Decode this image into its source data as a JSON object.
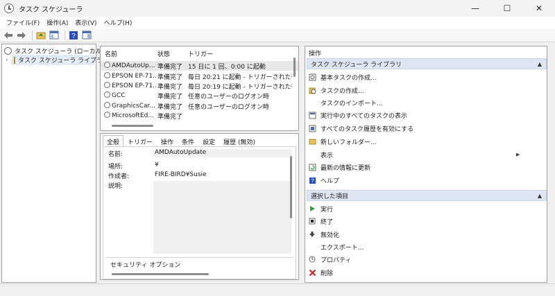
{
  "window": {
    "title": "タスク スケジューラ",
    "controls": {
      "minimize": "—",
      "maximize": "☐",
      "close": "✕"
    }
  },
  "menu": [
    "ファイル(F)",
    "操作(A)",
    "表示(V)",
    "ヘルプ(H)"
  ],
  "tree": {
    "root": "タスク スケジューラ (ローカル)",
    "child": "タスク スケジューラ ライブラリ",
    "expander": "›"
  },
  "tasklist": {
    "headers": {
      "name": "名前",
      "status": "状態",
      "trigger": "トリガー"
    },
    "rows": [
      {
        "name": "AMDAutoUp...",
        "status": "準備完了",
        "trigger": "15 日に 1 回、0:00 に起動"
      },
      {
        "name": "EPSON EP-71...",
        "status": "準備完了",
        "trigger": "毎日 20:21 に起動 - トリガーされた後、1 日"
      },
      {
        "name": "EPSON EP-71...",
        "status": "準備完了",
        "trigger": "毎日 20:19 に起動 - トリガーされた後、1 日"
      },
      {
        "name": "GCC",
        "status": "準備完了",
        "trigger": "任意のユーザーのログオン時"
      },
      {
        "name": "GraphicsCar...",
        "status": "準備完了",
        "trigger": "任意のユーザーのログオン時"
      },
      {
        "name": "MicrosoftEd...",
        "status": "準備完了",
        "trigger": ""
      }
    ]
  },
  "details": {
    "tabs": [
      "全般",
      "トリガー",
      "操作",
      "条件",
      "設定",
      "履歴 (無効)"
    ],
    "name_label": "名前:",
    "name_value": "AMDAutoUpdate",
    "location_label": "場所:",
    "location_value": "¥",
    "author_label": "作成者:",
    "author_value": "FIRE-BIRD¥Susie",
    "desc_label": "説明:",
    "security_label": "セキュリティ オプション"
  },
  "actions": {
    "title": "操作",
    "library_header": "タスク スケジューラ ライブラリ",
    "library_items": [
      {
        "label": "基本タスクの作成...",
        "icon": "wizard-icon"
      },
      {
        "label": "タスクの作成...",
        "icon": "create-task-icon"
      },
      {
        "label": "タスクのインポート...",
        "icon": ""
      },
      {
        "label": "実行中のすべてのタスクの表示",
        "icon": "running-tasks-icon"
      },
      {
        "label": "すべてのタスク履歴を有効にする",
        "icon": "history-icon"
      },
      {
        "label": "新しいフォルダー...",
        "icon": "folder-icon"
      },
      {
        "label": "表示",
        "icon": "",
        "submenu": "▶"
      },
      {
        "label": "最新の情報に更新",
        "icon": "refresh-icon"
      },
      {
        "label": "ヘルプ",
        "icon": "help-icon"
      }
    ],
    "selected_header": "選択した項目",
    "selected_items": [
      {
        "label": "実行",
        "icon": "run-icon"
      },
      {
        "label": "終了",
        "icon": "stop-icon"
      },
      {
        "label": "無効化",
        "icon": "disable-icon"
      },
      {
        "label": "エクスポート...",
        "icon": ""
      },
      {
        "label": "プロパティ",
        "icon": "properties-icon"
      },
      {
        "label": "削除",
        "icon": "delete-icon"
      }
    ],
    "collapse_glyph": "▲"
  },
  "colors": {
    "section_header_bg": "#dde6f2",
    "run_green": "#2e9e3a",
    "delete_red": "#d42020",
    "help_blue": "#2b4fb8"
  }
}
